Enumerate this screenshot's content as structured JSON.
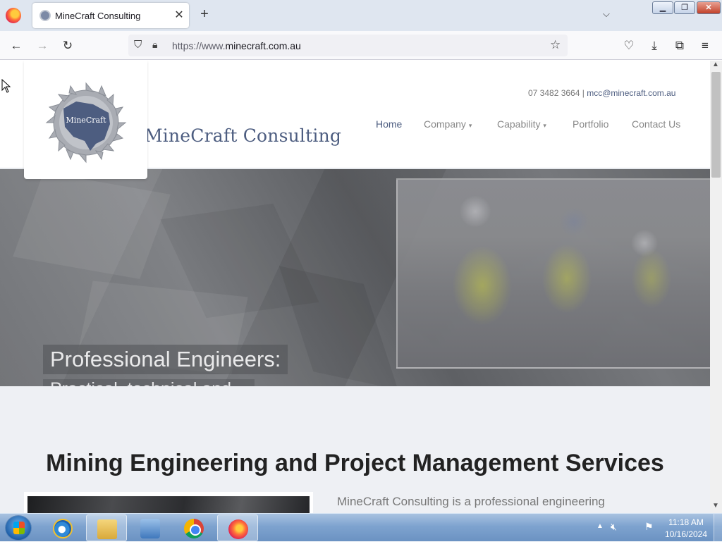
{
  "browser": {
    "tab_title": "MineCraft Consulting",
    "url_prefix": "https://www.",
    "url_domain": "minecraft.com.au",
    "icons": [
      "firefox-menu-icon",
      "site-favicon-icon",
      "close-icon",
      "plus-icon",
      "chevron-down-icon",
      "back-arrow-icon",
      "forward-arrow-icon",
      "reload-icon",
      "shield-icon",
      "lock-icon",
      "star-icon",
      "pocket-icon",
      "download-icon",
      "extensions-icon",
      "hamburger-menu-icon"
    ]
  },
  "site": {
    "logo_text": "MineCraft",
    "name": "MineCraft Consulting",
    "phone": "07 3482 3664",
    "separator": " | ",
    "email": "mcc@minecraft.com.au",
    "nav": [
      {
        "label": "Home",
        "caret": ""
      },
      {
        "label": "Company",
        "caret": "▾"
      },
      {
        "label": "Capability",
        "caret": "▾"
      },
      {
        "label": "Portfolio",
        "caret": ""
      },
      {
        "label": "Contact Us",
        "caret": ""
      }
    ],
    "active_nav": "Home",
    "hero": {
      "title": "Professional Engineers:",
      "subtitle": "Practical, technical and operational experience"
    },
    "section_title": "Mining Engineering and Project Management Services",
    "intro_text": "MineCraft Consulting is a professional engineering"
  },
  "taskbar": {
    "apps": [
      "Internet Explorer",
      "Windows Explorer",
      "Windows Media Player",
      "Google Chrome",
      "Firefox"
    ],
    "active_app": "Firefox",
    "time": "11:18 AM",
    "date": "10/16/2024"
  },
  "colors": {
    "brand": "#4d5d80",
    "hero_gray": "#6a6c70",
    "page_bg": "#eef0f4"
  }
}
